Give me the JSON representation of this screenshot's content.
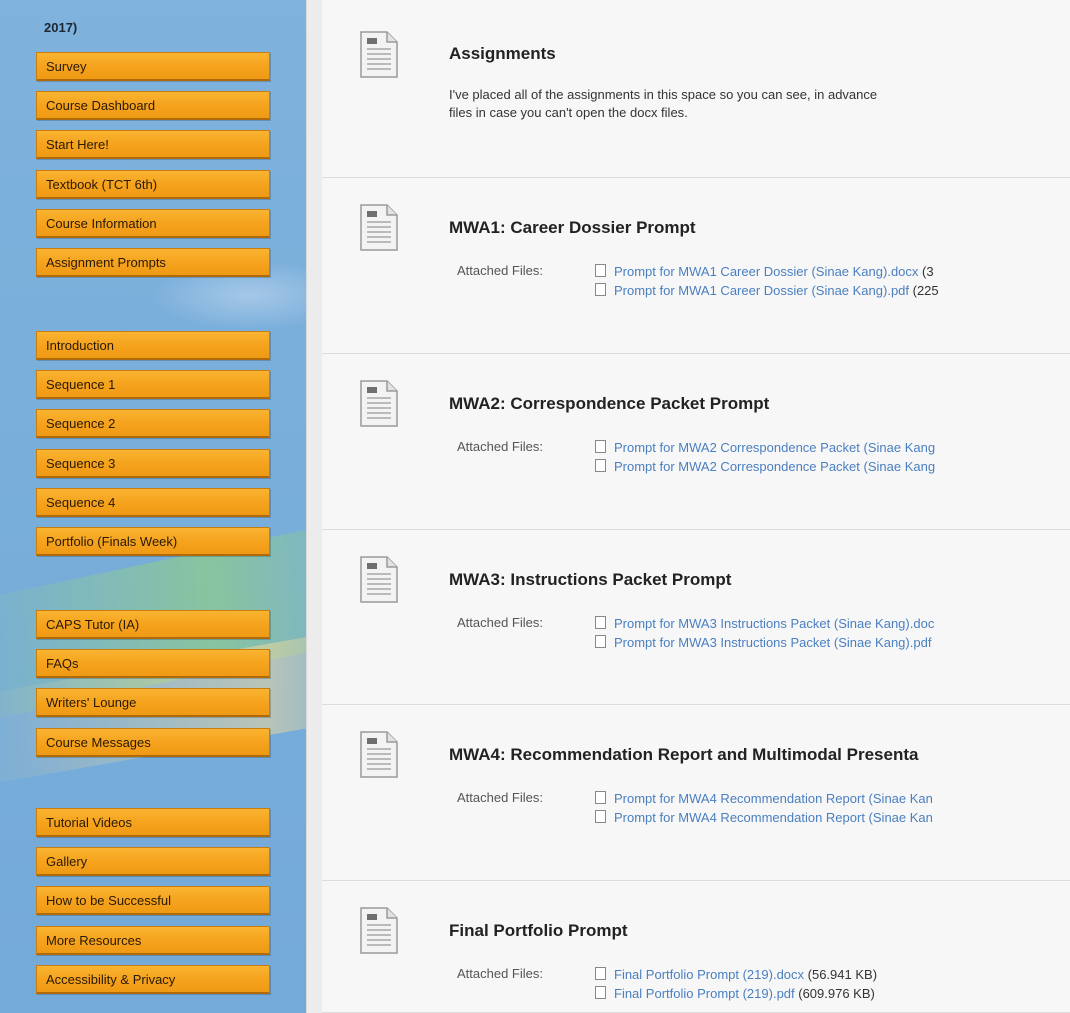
{
  "sidebar": {
    "year_text": "2017)",
    "groups": [
      [
        "Survey",
        "Course Dashboard",
        "Start Here!",
        "Textbook (TCT 6th)",
        "Course Information",
        "Assignment Prompts"
      ],
      [
        "Introduction",
        "Sequence 1",
        "Sequence 2",
        "Sequence 3",
        "Sequence 4",
        "Portfolio (Finals Week)"
      ],
      [
        "CAPS Tutor (IA)",
        "FAQs",
        "Writers' Lounge",
        "Course Messages"
      ],
      [
        "Tutorial Videos",
        "Gallery",
        "How to be Successful",
        "More Resources",
        "Accessibility & Privacy"
      ]
    ]
  },
  "content": {
    "attached_label": "Attached Files:",
    "items": [
      {
        "title": "Assignments",
        "description": "I've placed all of the assignments in this space so you can see, in advance\nfiles in case you can't open the docx files."
      },
      {
        "title": "MWA1: Career Dossier Prompt",
        "files": [
          {
            "name": "Prompt for MWA1 Career Dossier (Sinae Kang).docx",
            "size": " (3"
          },
          {
            "name": "Prompt for MWA1 Career Dossier (Sinae Kang).pdf",
            "size": " (225"
          }
        ]
      },
      {
        "title": "MWA2: Correspondence Packet Prompt",
        "files": [
          {
            "name": "Prompt for MWA2 Correspondence Packet (Sinae Kang",
            "size": ""
          },
          {
            "name": "Prompt for MWA2 Correspondence Packet (Sinae Kang",
            "size": ""
          }
        ]
      },
      {
        "title": "MWA3: Instructions Packet Prompt",
        "files": [
          {
            "name": "Prompt for MWA3 Instructions Packet (Sinae Kang).doc",
            "size": ""
          },
          {
            "name": "Prompt for MWA3 Instructions Packet (Sinae Kang).pdf",
            "size": ""
          }
        ]
      },
      {
        "title": "MWA4: Recommendation Report and Multimodal Presenta",
        "files": [
          {
            "name": "Prompt for MWA4 Recommendation Report (Sinae Kan",
            "size": ""
          },
          {
            "name": "Prompt for MWA4 Recommendation Report (Sinae Kan",
            "size": ""
          }
        ]
      },
      {
        "title": "Final Portfolio Prompt",
        "files": [
          {
            "name": "Final Portfolio Prompt (219).docx",
            "size": " (56.941 KB)"
          },
          {
            "name": "Final Portfolio Prompt (219).pdf",
            "size": " (609.976 KB)"
          }
        ]
      }
    ]
  }
}
